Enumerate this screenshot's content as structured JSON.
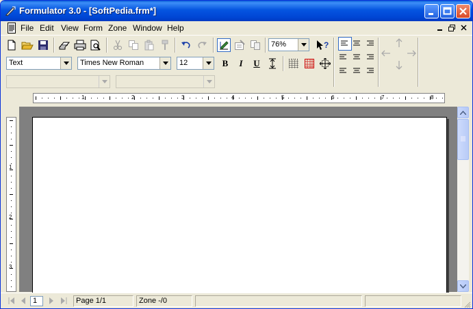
{
  "window": {
    "title": "Formulator 3.0 - [SoftPedia.frm*]"
  },
  "menu": {
    "items": [
      "File",
      "Edit",
      "View",
      "Form",
      "Zone",
      "Window",
      "Help"
    ]
  },
  "toolbar": {
    "zoom": "76%",
    "style": "Text",
    "font": "Times New Roman",
    "size": "12",
    "bold": "B",
    "italic": "I",
    "underline": "U",
    "combo3": "",
    "combo4": ""
  },
  "ruler": {
    "h_numbers": [
      "1",
      "2",
      "3",
      "4",
      "5",
      "6",
      "7",
      "8"
    ],
    "v_numbers": [
      "1",
      "2",
      "3"
    ]
  },
  "status": {
    "page_input": "1",
    "page": "Page 1/1",
    "zone": "Zone -/0"
  },
  "colors": {
    "titlebar": "#0054e3",
    "workspace": "#808080",
    "paper": "#ffffff"
  }
}
